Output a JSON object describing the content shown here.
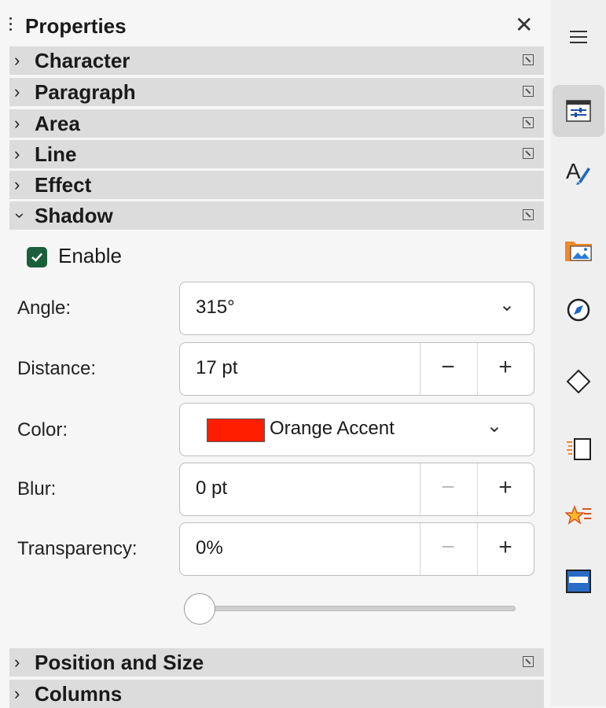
{
  "panel": {
    "title": "Properties",
    "close_glyph": "✕"
  },
  "sections": {
    "character": "Character",
    "paragraph": "Paragraph",
    "area": "Area",
    "line": "Line",
    "effect": "Effect",
    "shadow": "Shadow",
    "position_size": "Position and Size",
    "columns": "Columns"
  },
  "shadow": {
    "enable_label": "Enable",
    "enable_checked": true,
    "angle_label": "Angle:",
    "angle_value": "315°",
    "distance_label": "Distance:",
    "distance_value": "17 pt",
    "color_label": "Color:",
    "color_name": "Orange Accent",
    "color_hex": "#ff1e00",
    "blur_label": "Blur:",
    "blur_value": "0 pt",
    "transparency_label": "Transparency:",
    "transparency_value": "0%",
    "transparency_slider": 0
  },
  "deck": {
    "menu_icon": "hamburger-menu-icon",
    "items": [
      "properties-icon",
      "styles-icon",
      "gallery-icon",
      "navigator-icon",
      "shapes-icon",
      "page-icon",
      "animation-icon",
      "slide-transition-icon"
    ],
    "active": "properties-icon"
  }
}
